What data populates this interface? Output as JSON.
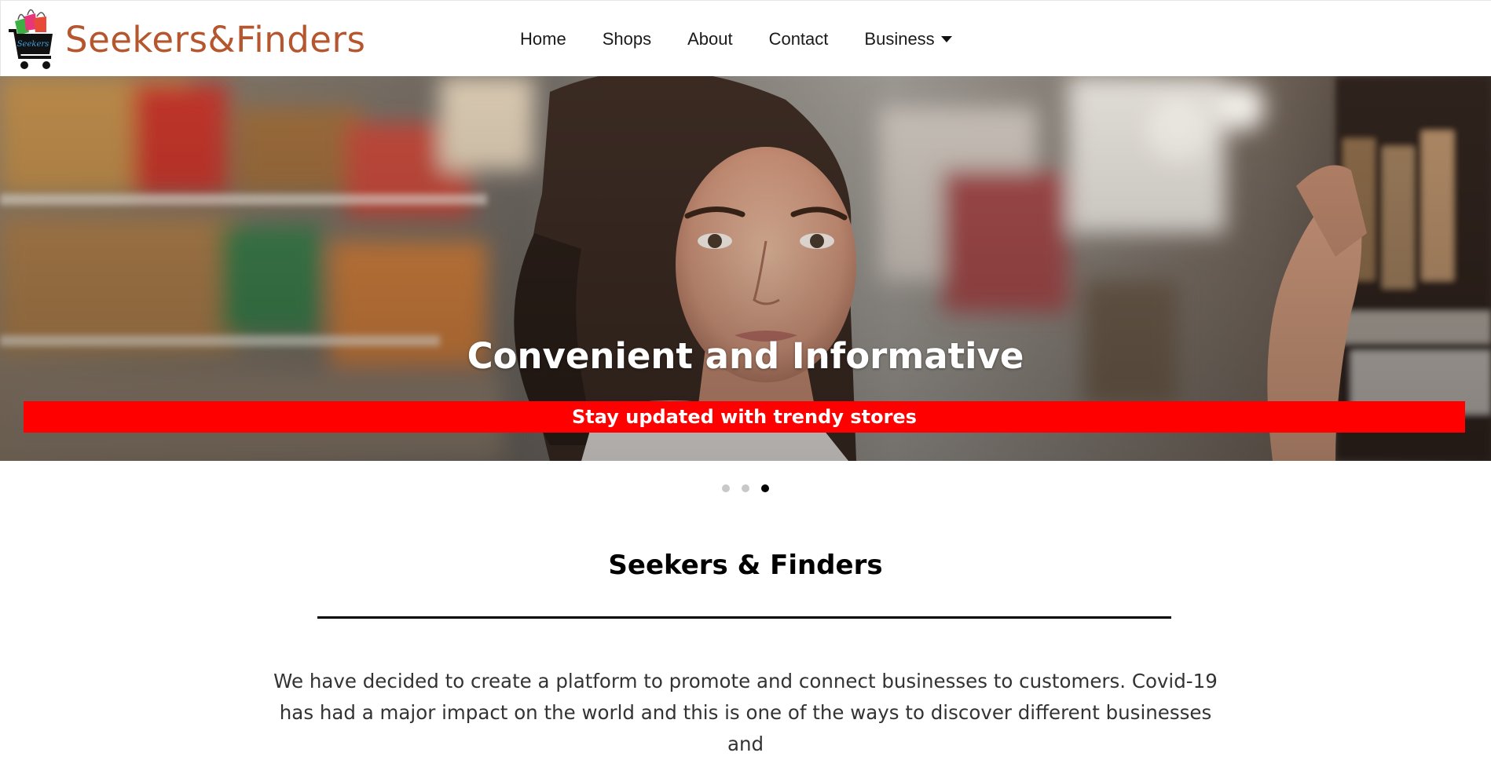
{
  "navbar": {
    "brand_name": "Seekers&Finders",
    "logo_text": "Seekers",
    "links": [
      "Home",
      "Shops",
      "About",
      "Contact",
      "Business"
    ]
  },
  "hero": {
    "title": "Convenient and Informative",
    "banner": "Stay updated with trendy stores",
    "banner_color": "#ff0000",
    "slide_count": 3,
    "active_slide": 3
  },
  "about": {
    "title": "Seekers & Finders",
    "intro": "We have decided to create a platform to promote and connect businesses to customers. Covid-19 has had a major impact on the world and this is one of the ways to discover different businesses and"
  },
  "colors": {
    "brand": "#b5562e",
    "accent": "#ff0000"
  }
}
